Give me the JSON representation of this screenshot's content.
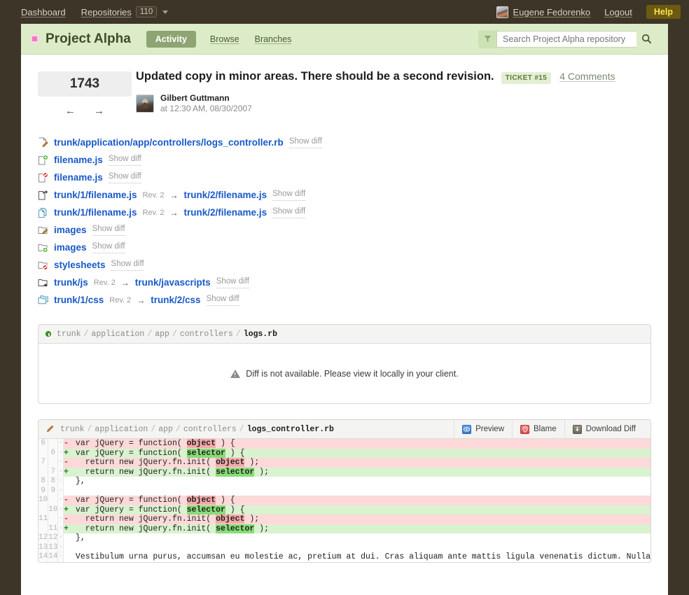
{
  "topnav": {
    "dashboard": "Dashboard",
    "repositories": "Repositories",
    "repo_count": "110",
    "user_name": "Eugene Fedorenko",
    "logout": "Logout",
    "help": "Help"
  },
  "projectbar": {
    "title": "Project Alpha",
    "tabs": [
      {
        "label": "Activity",
        "active": true
      },
      {
        "label": "Browse",
        "active": false
      },
      {
        "label": "Branches",
        "active": false
      }
    ],
    "search_placeholder": "Search Project Alpha repository",
    "search_value": ""
  },
  "commit": {
    "revision": "1743",
    "prev_arrow": "←",
    "next_arrow": "→",
    "title": "Updated copy in minor areas. There should be a second revision.",
    "ticket": "TICKET #15",
    "comments": "4 Comments",
    "author": "Gilbert Guttmann",
    "date": "at 12:30 AM, 08/30/2007"
  },
  "files": [
    {
      "icon": "file-modified-icon",
      "name": "trunk/application/app/controllers/logs_controller.rb",
      "rev": "",
      "target": "",
      "action": "Show diff"
    },
    {
      "icon": "file-added-icon",
      "name": "filename.js",
      "rev": "",
      "target": "",
      "action": "Show diff"
    },
    {
      "icon": "file-deleted-icon",
      "name": "filename.js",
      "rev": "",
      "target": "",
      "action": "Show diff"
    },
    {
      "icon": "file-moved-icon",
      "name": "trunk/1/filename.js",
      "rev": "Rev. 2",
      "target": "trunk/2/filename.js",
      "action": "Show diff"
    },
    {
      "icon": "file-copied-icon",
      "name": "trunk/1/filename.js",
      "rev": "Rev. 2",
      "target": "trunk/2/filename.js",
      "action": "Show diff"
    },
    {
      "icon": "folder-modified-icon",
      "name": "images",
      "rev": "",
      "target": "",
      "action": "Show diff"
    },
    {
      "icon": "folder-added-icon",
      "name": "images",
      "rev": "",
      "target": "",
      "action": "Show diff"
    },
    {
      "icon": "folder-deleted-icon",
      "name": "stylesheets",
      "rev": "",
      "target": "",
      "action": "Show diff"
    },
    {
      "icon": "folder-moved-icon",
      "name": "trunk/js",
      "rev": "Rev. 2",
      "target": "trunk/javascripts",
      "action": "Show diff"
    },
    {
      "icon": "folder-copied-icon",
      "name": "trunk/1/css",
      "rev": "Rev. 2",
      "target": "trunk/2/css",
      "action": "Show diff"
    }
  ],
  "panel_empty": {
    "crumb_parts": [
      "trunk",
      "application",
      "app",
      "controllers"
    ],
    "crumb_file": "logs.rb",
    "message": "Diff is not available. Please view it locally in your client."
  },
  "panel_diff": {
    "crumb_parts": [
      "trunk",
      "application",
      "app",
      "controllers"
    ],
    "crumb_file": "logs_controller.rb",
    "actions": [
      {
        "label": "Preview",
        "icon": "preview-eye-icon"
      },
      {
        "label": "Blame",
        "icon": "blame-pin-icon"
      },
      {
        "label": "Download Diff",
        "icon": "download-arrow-icon"
      }
    ],
    "rows": [
      {
        "old": "6",
        "new": "",
        "type": "del",
        "sign": "-",
        "pre": " var jQuery = function( ",
        "hl": "object",
        "post": " ) {"
      },
      {
        "old": "",
        "new": "6",
        "type": "add",
        "sign": "+",
        "pre": " var jQuery = function( ",
        "hl": "selector",
        "post": " ) {"
      },
      {
        "old": "7",
        "new": "",
        "type": "del",
        "sign": "-",
        "pre": "   return new jQuery.fn.init( ",
        "hl": "object",
        "post": " );"
      },
      {
        "old": "",
        "new": "7",
        "type": "add",
        "sign": "+",
        "pre": "   return new jQuery.fn.init( ",
        "hl": "selector",
        "post": " );"
      },
      {
        "old": "8",
        "new": "8",
        "type": "ctx",
        "sign": " ",
        "pre": " },",
        "hl": "",
        "post": ""
      },
      {
        "old": "9",
        "new": "9",
        "type": "ctx",
        "sign": " ",
        "pre": "",
        "hl": "",
        "post": ""
      },
      {
        "old": "10",
        "new": "",
        "type": "del",
        "sign": "-",
        "pre": " var jQuery = function( ",
        "hl": "object",
        "post": " ) {"
      },
      {
        "old": "",
        "new": "10",
        "type": "add",
        "sign": "+",
        "pre": " var jQuery = function( ",
        "hl": "selector",
        "post": " ) {"
      },
      {
        "old": "11",
        "new": "",
        "type": "del",
        "sign": "-",
        "pre": "   return new jQuery.fn.init( ",
        "hl": "object",
        "post": " );"
      },
      {
        "old": "",
        "new": "11",
        "type": "add",
        "sign": "+",
        "pre": "   return new jQuery.fn.init( ",
        "hl": "selector",
        "post": " );"
      },
      {
        "old": "12",
        "new": "12",
        "type": "ctx",
        "sign": " ",
        "pre": " },",
        "hl": "",
        "post": ""
      },
      {
        "old": "13",
        "new": "13",
        "type": "ctx",
        "sign": " ",
        "pre": "",
        "hl": "",
        "post": ""
      },
      {
        "old": "14",
        "new": "14",
        "type": "ctx",
        "sign": " ",
        "pre": " Vestibulum urna purus, accumsan eu molestie ac, pretium at dui. Cras aliquam ante mattis ligula venenatis dictum. Nullam ac ipsum ac ",
        "hl": "",
        "post": ""
      }
    ]
  },
  "colors": {
    "frame": "#3d3528",
    "project_bar": "#dcecc8",
    "link_blue": "#1959c8",
    "help_yellow": "#ffe14d",
    "diff_add": "#d9f2cf",
    "diff_del": "#fdd9d9"
  }
}
